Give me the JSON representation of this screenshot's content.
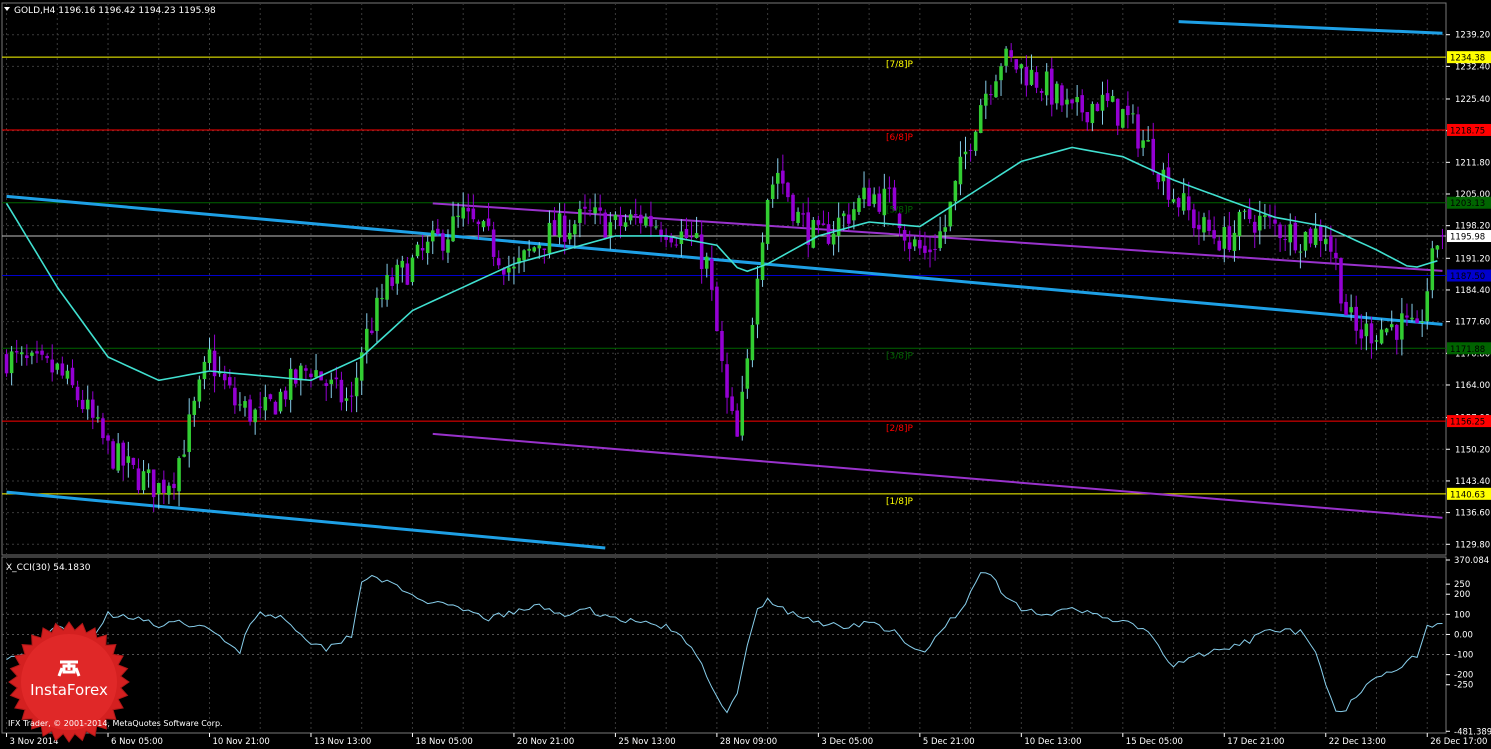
{
  "header": {
    "title": "GOLD,H4  1196.16 1196.42 1194.23 1195.98",
    "menu_icon": "triangle-down-icon"
  },
  "footer": {
    "copyright": "IFX Trader, © 2001-2014, MetaQuotes Software Corp."
  },
  "logo": {
    "text": "InstaForex",
    "icon": "instaforex-seal-icon"
  },
  "colors": {
    "background": "#000000",
    "grid": "#3a3a3a",
    "axis_text": "#ffffff",
    "bull": "#32cd32",
    "bear": "#9400d3",
    "shadow_bull": "#87ceeb",
    "trend_cyan": "#1ea0e6",
    "channel_violet": "#9932cc",
    "ma": "#40e0d0",
    "murrey_yellow": "#ffff00",
    "murrey_red": "#ff0000",
    "murrey_green": "#006400",
    "current_price": "#c0c0c0",
    "blue_level": "#0000cd",
    "cci_line": "#87ceeb"
  },
  "chart_data": [
    {
      "type": "candlestick",
      "symbol": "GOLD",
      "timeframe": "H4",
      "ohlc_header": {
        "open": 1196.16,
        "high": 1196.42,
        "low": 1194.23,
        "close": 1195.98
      },
      "y_ticks": [
        "1239.20",
        "1232.40",
        "1225.40",
        "1218.60",
        "1211.80",
        "1205.00",
        "1198.20",
        "1191.20",
        "1184.40",
        "1177.60",
        "1170.80",
        "1164.00",
        "1157.00",
        "1150.20",
        "1143.40",
        "1136.60",
        "1129.80"
      ],
      "ylim": [
        1127.5,
        1243.0
      ],
      "x_ticks": [
        "3 Nov 2014",
        "6 Nov 05:00",
        "10 Nov 21:00",
        "13 Nov 13:00",
        "18 Nov 05:00",
        "20 Nov 21:00",
        "25 Nov 13:00",
        "28 Nov 09:00",
        "3 Dec 05:00",
        "5 Dec 21:00",
        "10 Dec 13:00",
        "15 Dec 05:00",
        "17 Dec 21:00",
        "22 Dec 13:00",
        "26 Dec 17:00"
      ],
      "x_tick_index": [
        0,
        20,
        40,
        60,
        80,
        100,
        120,
        140,
        160,
        180,
        200,
        220,
        240,
        260,
        280
      ],
      "bar_count": 284,
      "close_path": [
        [
          0,
          1170.0
        ],
        [
          5,
          1168.0
        ],
        [
          10,
          1167.0
        ],
        [
          15,
          1160.0
        ],
        [
          20,
          1150.0
        ],
        [
          25,
          1145.0
        ],
        [
          30,
          1142.0
        ],
        [
          33,
          1145.0
        ],
        [
          36,
          1155.0
        ],
        [
          40,
          1170.0
        ],
        [
          45,
          1160.0
        ],
        [
          50,
          1157.0
        ],
        [
          55,
          1163.0
        ],
        [
          60,
          1168.0
        ],
        [
          65,
          1162.0
        ],
        [
          68,
          1160.0
        ],
        [
          70,
          1172.0
        ],
        [
          75,
          1185.0
        ],
        [
          80,
          1190.0
        ],
        [
          85,
          1195.0
        ],
        [
          90,
          1200.0
        ],
        [
          95,
          1195.0
        ],
        [
          100,
          1188.0
        ],
        [
          105,
          1195.0
        ],
        [
          110,
          1198.0
        ],
        [
          115,
          1200.0
        ],
        [
          120,
          1198.0
        ],
        [
          125,
          1200.0
        ],
        [
          130,
          1198.0
        ],
        [
          135,
          1195.0
        ],
        [
          138,
          1190.0
        ],
        [
          140,
          1175.0
        ],
        [
          142,
          1160.0
        ],
        [
          144,
          1152.0
        ],
        [
          146,
          1168.0
        ],
        [
          148,
          1190.0
        ],
        [
          150,
          1205.0
        ],
        [
          152,
          1210.0
        ],
        [
          156,
          1200.0
        ],
        [
          160,
          1195.0
        ],
        [
          165,
          1200.0
        ],
        [
          170,
          1205.0
        ],
        [
          175,
          1203.0
        ],
        [
          178,
          1195.0
        ],
        [
          181,
          1192.0
        ],
        [
          185,
          1198.0
        ],
        [
          188,
          1210.0
        ],
        [
          192,
          1225.0
        ],
        [
          196,
          1234.0
        ],
        [
          200,
          1232.0
        ],
        [
          205,
          1228.0
        ],
        [
          210,
          1222.0
        ],
        [
          215,
          1225.0
        ],
        [
          220,
          1222.0
        ],
        [
          225,
          1215.0
        ],
        [
          230,
          1205.0
        ],
        [
          235,
          1198.0
        ],
        [
          240,
          1195.0
        ],
        [
          245,
          1200.0
        ],
        [
          250,
          1198.0
        ],
        [
          255,
          1196.0
        ],
        [
          260,
          1197.0
        ],
        [
          262,
          1190.0
        ],
        [
          264,
          1180.0
        ],
        [
          266,
          1175.0
        ],
        [
          270,
          1176.0
        ],
        [
          275,
          1177.0
        ],
        [
          278,
          1174.0
        ],
        [
          280,
          1185.0
        ],
        [
          282,
          1195.0
        ],
        [
          283,
          1195.98
        ]
      ],
      "ma_path": [
        [
          0,
          1203.0
        ],
        [
          10,
          1185.0
        ],
        [
          20,
          1170.0
        ],
        [
          30,
          1165.0
        ],
        [
          40,
          1167.0
        ],
        [
          50,
          1166.0
        ],
        [
          60,
          1165.0
        ],
        [
          70,
          1170.0
        ],
        [
          80,
          1180.0
        ],
        [
          90,
          1185.0
        ],
        [
          100,
          1190.0
        ],
        [
          110,
          1193.0
        ],
        [
          120,
          1196.0
        ],
        [
          130,
          1196.0
        ],
        [
          140,
          1194.0
        ],
        [
          145,
          1188.0
        ],
        [
          150,
          1190.0
        ],
        [
          160,
          1196.0
        ],
        [
          170,
          1199.0
        ],
        [
          180,
          1198.0
        ],
        [
          190,
          1205.0
        ],
        [
          200,
          1212.0
        ],
        [
          210,
          1215.0
        ],
        [
          220,
          1213.0
        ],
        [
          230,
          1208.0
        ],
        [
          240,
          1204.0
        ],
        [
          250,
          1200.0
        ],
        [
          260,
          1198.0
        ],
        [
          270,
          1193.0
        ],
        [
          277,
          1189.0
        ],
        [
          283,
          1191.0
        ]
      ],
      "murrey_levels": [
        {
          "label": "[7/8]P",
          "value": 1234.38,
          "color": "#ffff00",
          "tag_bg": "#ffff00",
          "tag_fg": "#000000"
        },
        {
          "label": "[6/8]P",
          "value": 1218.75,
          "color": "#ff0000",
          "tag_bg": "#ff0000",
          "tag_fg": "#000000"
        },
        {
          "label": "[5/8]P",
          "value": 1203.13,
          "color": "#006400",
          "tag_bg": "#006400",
          "tag_fg": "#000000"
        },
        {
          "label": "[3/8]P",
          "value": 1171.88,
          "color": "#006400",
          "tag_bg": "#006400",
          "tag_fg": "#000000"
        },
        {
          "label": "[2/8]P",
          "value": 1156.25,
          "color": "#ff0000",
          "tag_bg": "#ff0000",
          "tag_fg": "#000000"
        },
        {
          "label": "[1/8]P",
          "value": 1140.63,
          "color": "#ffff00",
          "tag_bg": "#ffff00",
          "tag_fg": "#000000"
        }
      ],
      "extra_levels": [
        {
          "value": 1195.98,
          "color": "#c0c0c0",
          "tag_bg": "#ffffff",
          "tag_fg": "#000000",
          "tag_text": "1195.98"
        },
        {
          "value": 1187.5,
          "color": "#0000cd",
          "tag_bg": "#0000cd",
          "tag_fg": "#000000",
          "tag_text": "1187.50"
        }
      ],
      "trend_lines": [
        {
          "color": "#1ea0e6",
          "width": 3,
          "from": [
            0,
            1204.5
          ],
          "to": [
            283,
            1177.0
          ]
        },
        {
          "color": "#1ea0e6",
          "width": 3,
          "from": [
            0,
            1141.0
          ],
          "to": [
            118,
            1129.0
          ]
        },
        {
          "color": "#1ea0e6",
          "width": 3,
          "from": [
            231,
            1242.0
          ],
          "to": [
            283,
            1239.5
          ]
        },
        {
          "color": "#9932cc",
          "width": 2,
          "from": [
            84,
            1203.0
          ],
          "to": [
            283,
            1188.5
          ]
        },
        {
          "color": "#9932cc",
          "width": 2,
          "from": [
            84,
            1153.5
          ],
          "to": [
            283,
            1135.5
          ]
        }
      ]
    },
    {
      "type": "line",
      "name": "X_CCI(30)",
      "label": "X_CCI(30) 54.1830",
      "y_ticks": [
        "370.084",
        "250",
        "200",
        "100",
        "0.00",
        "-100",
        "-200",
        "-250",
        "-481.3897"
      ],
      "y_tick_values": [
        370.084,
        250,
        200,
        100,
        0,
        -100,
        -200,
        -250,
        -481.3897
      ],
      "ylim": [
        -490,
        385
      ],
      "path": [
        [
          0,
          -110
        ],
        [
          5,
          -100
        ],
        [
          10,
          50
        ],
        [
          15,
          -80
        ],
        [
          20,
          100
        ],
        [
          25,
          90
        ],
        [
          30,
          40
        ],
        [
          35,
          60
        ],
        [
          40,
          20
        ],
        [
          43,
          -30
        ],
        [
          46,
          -80
        ],
        [
          48,
          60
        ],
        [
          50,
          110
        ],
        [
          53,
          90
        ],
        [
          55,
          80
        ],
        [
          60,
          -40
        ],
        [
          63,
          -70
        ],
        [
          66,
          -30
        ],
        [
          68,
          0
        ],
        [
          70,
          260
        ],
        [
          72,
          300
        ],
        [
          75,
          260
        ],
        [
          80,
          190
        ],
        [
          85,
          150
        ],
        [
          90,
          120
        ],
        [
          95,
          80
        ],
        [
          100,
          110
        ],
        [
          105,
          140
        ],
        [
          110,
          100
        ],
        [
          115,
          120
        ],
        [
          120,
          80
        ],
        [
          125,
          60
        ],
        [
          130,
          40
        ],
        [
          135,
          -60
        ],
        [
          138,
          -200
        ],
        [
          140,
          -300
        ],
        [
          142,
          -390
        ],
        [
          144,
          -300
        ],
        [
          146,
          -60
        ],
        [
          148,
          120
        ],
        [
          150,
          170
        ],
        [
          155,
          100
        ],
        [
          160,
          60
        ],
        [
          165,
          40
        ],
        [
          170,
          60
        ],
        [
          175,
          10
        ],
        [
          178,
          -70
        ],
        [
          181,
          -90
        ],
        [
          185,
          50
        ],
        [
          188,
          110
        ],
        [
          190,
          200
        ],
        [
          192,
          310
        ],
        [
          194,
          300
        ],
        [
          196,
          220
        ],
        [
          200,
          130
        ],
        [
          205,
          100
        ],
        [
          210,
          120
        ],
        [
          215,
          100
        ],
        [
          220,
          60
        ],
        [
          225,
          20
        ],
        [
          228,
          -110
        ],
        [
          230,
          -160
        ],
        [
          233,
          -120
        ],
        [
          235,
          -100
        ],
        [
          240,
          -80
        ],
        [
          245,
          -30
        ],
        [
          250,
          30
        ],
        [
          255,
          10
        ],
        [
          258,
          -100
        ],
        [
          260,
          -250
        ],
        [
          262,
          -390
        ],
        [
          264,
          -380
        ],
        [
          266,
          -300
        ],
        [
          270,
          -200
        ],
        [
          275,
          -160
        ],
        [
          278,
          -100
        ],
        [
          280,
          40
        ],
        [
          283,
          54.183
        ]
      ]
    }
  ]
}
